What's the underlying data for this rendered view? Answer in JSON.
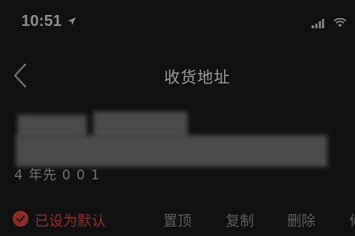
{
  "status_bar": {
    "time": "10:51"
  },
  "nav": {
    "title": "收货地址"
  },
  "address": {
    "line2_fragment": "4 年先 0 0 1"
  },
  "actions": {
    "default_label": "已设为默认",
    "pin_label": "置顶",
    "copy_label": "复制",
    "delete_label": "删除",
    "edit_label": "修"
  },
  "colors": {
    "background": "#111111",
    "accent_red": "#8e2a2a",
    "text_muted": "#5c5c5c"
  }
}
